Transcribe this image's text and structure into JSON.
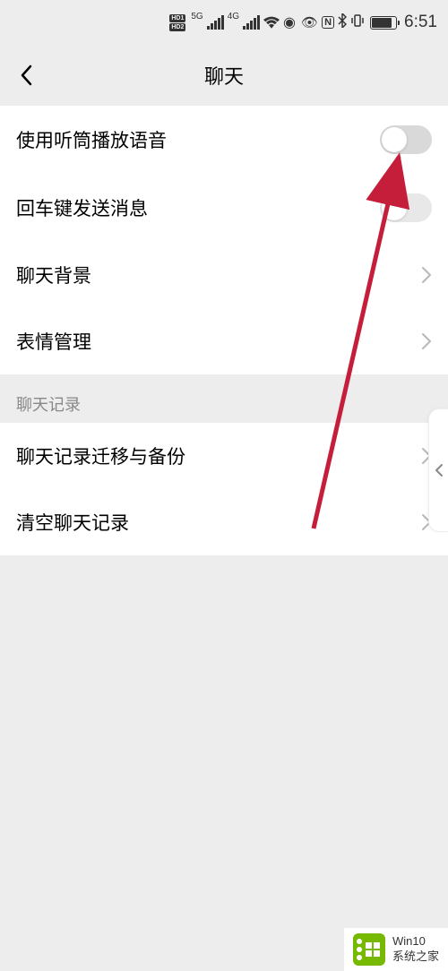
{
  "status_bar": {
    "hd1": "HD1",
    "hd2": "HD2",
    "net1": "5G",
    "net2": "4G",
    "time": "6:51"
  },
  "header": {
    "title": "聊天"
  },
  "group1": {
    "row1": {
      "label": "使用听筒播放语音"
    },
    "row2": {
      "label": "回车键发送消息"
    },
    "row3": {
      "label": "聊天背景"
    },
    "row4": {
      "label": "表情管理"
    }
  },
  "section2": {
    "header": "聊天记录",
    "row1": {
      "label": "聊天记录迁移与备份"
    },
    "row2": {
      "label": "清空聊天记录"
    }
  },
  "watermark": {
    "line1": "Win10",
    "line2": "系统之家"
  }
}
